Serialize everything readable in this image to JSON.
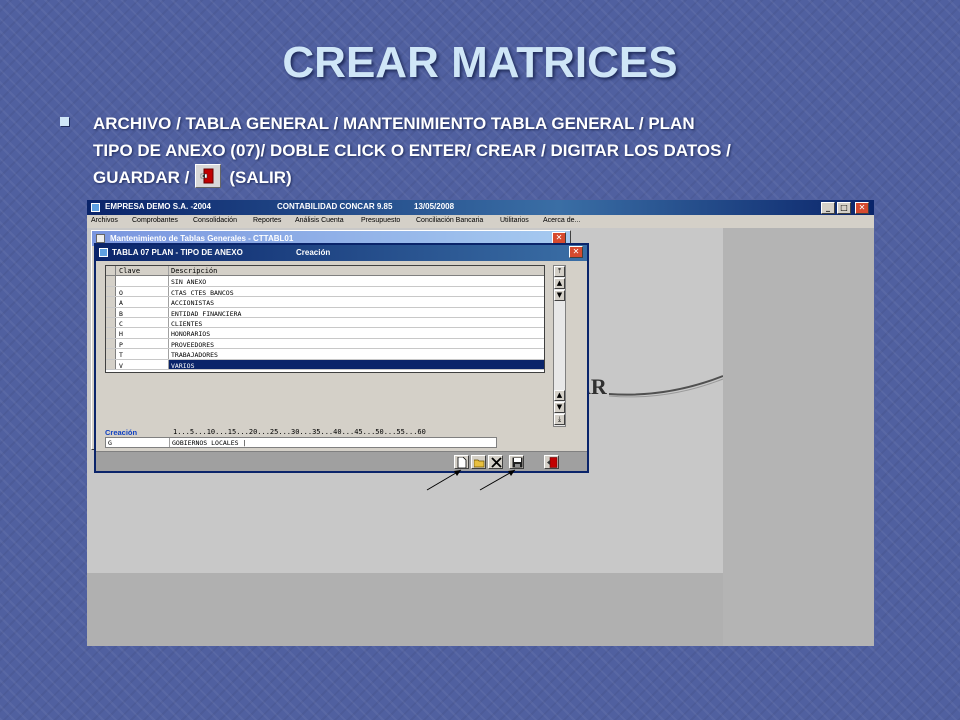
{
  "slide": {
    "title": "CREAR MATRICES",
    "bullet_lines": [
      "ARCHIVO / TABLA GENERAL / MANTENIMIENTO TABLA GENERAL / PLAN",
      "TIPO DE ANEXO (07)/ DOBLE CLICK O ENTER/ CREAR / DIGITAR LOS DATOS /",
      "GUARDAR /",
      "(SALIR)"
    ]
  },
  "app": {
    "company": "EMPRESA DEMO S.A. -2004",
    "product": "CONTABILIDAD CONCAR 9.85",
    "date": "13/05/2008",
    "window_buttons": {
      "minimize": "_",
      "maximize": "□",
      "close": "✕"
    },
    "menu": [
      "Archivos",
      "Comprobantes",
      "Consolidación",
      "Reportes",
      "Análisis Cuenta",
      "Presupuesto",
      "Conciliación Bancaria",
      "Utilitarios",
      "Acerca de..."
    ],
    "background_text": "AR",
    "maintenance_window_title": "Mantenimiento de Tablas Generales - CTTABL01"
  },
  "dialog": {
    "title": "TABLA 07 PLAN - TIPO DE ANEXO",
    "mode": "Creación",
    "columns": {
      "key": "Clave",
      "description": "Descripción"
    },
    "rows": [
      {
        "key": "",
        "description": "SIN ANEXO"
      },
      {
        "key": "O",
        "description": "CTAS CTES BANCOS"
      },
      {
        "key": "A",
        "description": "ACCIONISTAS"
      },
      {
        "key": "B",
        "description": "ENTIDAD FINANCIERA"
      },
      {
        "key": "C",
        "description": "CLIENTES"
      },
      {
        "key": "H",
        "description": "HONORARIOS"
      },
      {
        "key": "P",
        "description": "PROVEEDORES"
      },
      {
        "key": "T",
        "description": "TRABAJADORES"
      },
      {
        "key": "V",
        "description": "VARIOS"
      }
    ],
    "selected_row": 8,
    "create_label": "Creación",
    "ruler": "1...5...10...15...20...25...30...35...40...45...50...55...60",
    "entry": {
      "key": "G",
      "description": "GOBIERNOS LOCALES |"
    },
    "toolbar_icons": [
      "new-document-icon",
      "open-folder-icon",
      "delete-x-icon",
      "save-disk-icon",
      "exit-door-icon"
    ]
  },
  "colors": {
    "accent": "#0a246a",
    "slide_bg": "#5060a0",
    "title": "#cfe6f7"
  }
}
